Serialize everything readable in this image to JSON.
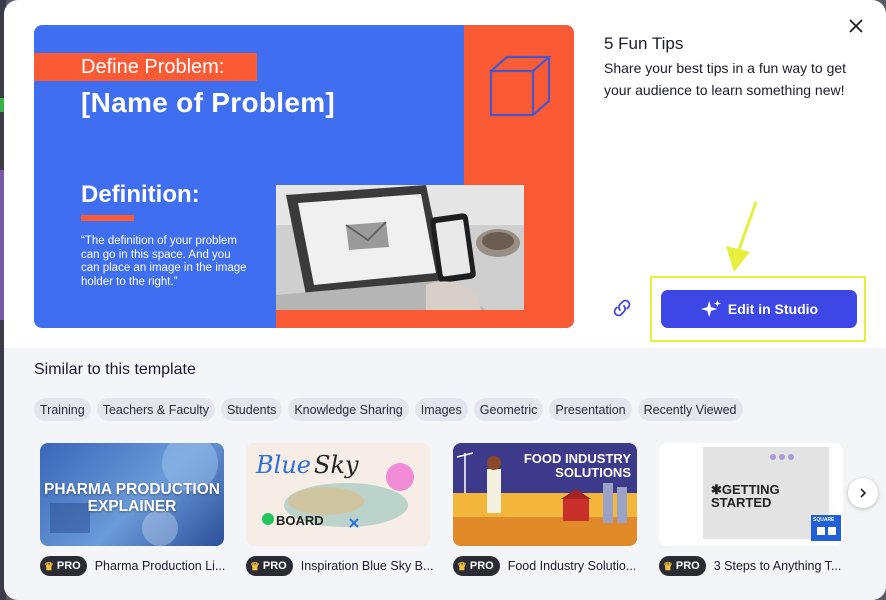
{
  "template": {
    "title": "5 Fun Tips",
    "description": "Share your best tips in a fun way to get your audience to learn something new!"
  },
  "preview": {
    "label": "Define Problem:",
    "headline": "[Name of Problem]",
    "definition_title": "Definition:",
    "definition_body": "“The definition of your problem can go in this space. And you can place an image in the image holder to the right.”"
  },
  "actions": {
    "edit_label": "Edit in Studio",
    "close_icon": "close-icon",
    "link_icon": "link-icon"
  },
  "similar": {
    "title": "Similar to this template",
    "tags": [
      "Training",
      "Teachers & Faculty",
      "Students",
      "Knowledge Sharing",
      "Images",
      "Geometric",
      "Presentation",
      "Recently Viewed"
    ],
    "cards": [
      {
        "name": "Pharma Production Li...",
        "badge": "PRO",
        "thumb_text": "PHARMA PRODUCTION EXPLAINER"
      },
      {
        "name": "Inspiration Blue Sky B...",
        "badge": "PRO",
        "thumb_text_1": "Blue",
        "thumb_text_2": "Sky",
        "thumb_text_3": "BOARD"
      },
      {
        "name": "Food Industry Solutio...",
        "badge": "PRO",
        "thumb_text": "FOOD INDUSTRY SOLUTIONS"
      },
      {
        "name": "3 Steps to Anything T...",
        "badge": "PRO",
        "thumb_text": "✱GETTING STARTED",
        "thumb_badge": "SQUARE"
      }
    ]
  },
  "colors": {
    "accent": "#3d47e6",
    "slide_blue": "#3f6ef0",
    "slide_orange": "#fa5b34",
    "annotation_yellow": "#e6f03c"
  }
}
